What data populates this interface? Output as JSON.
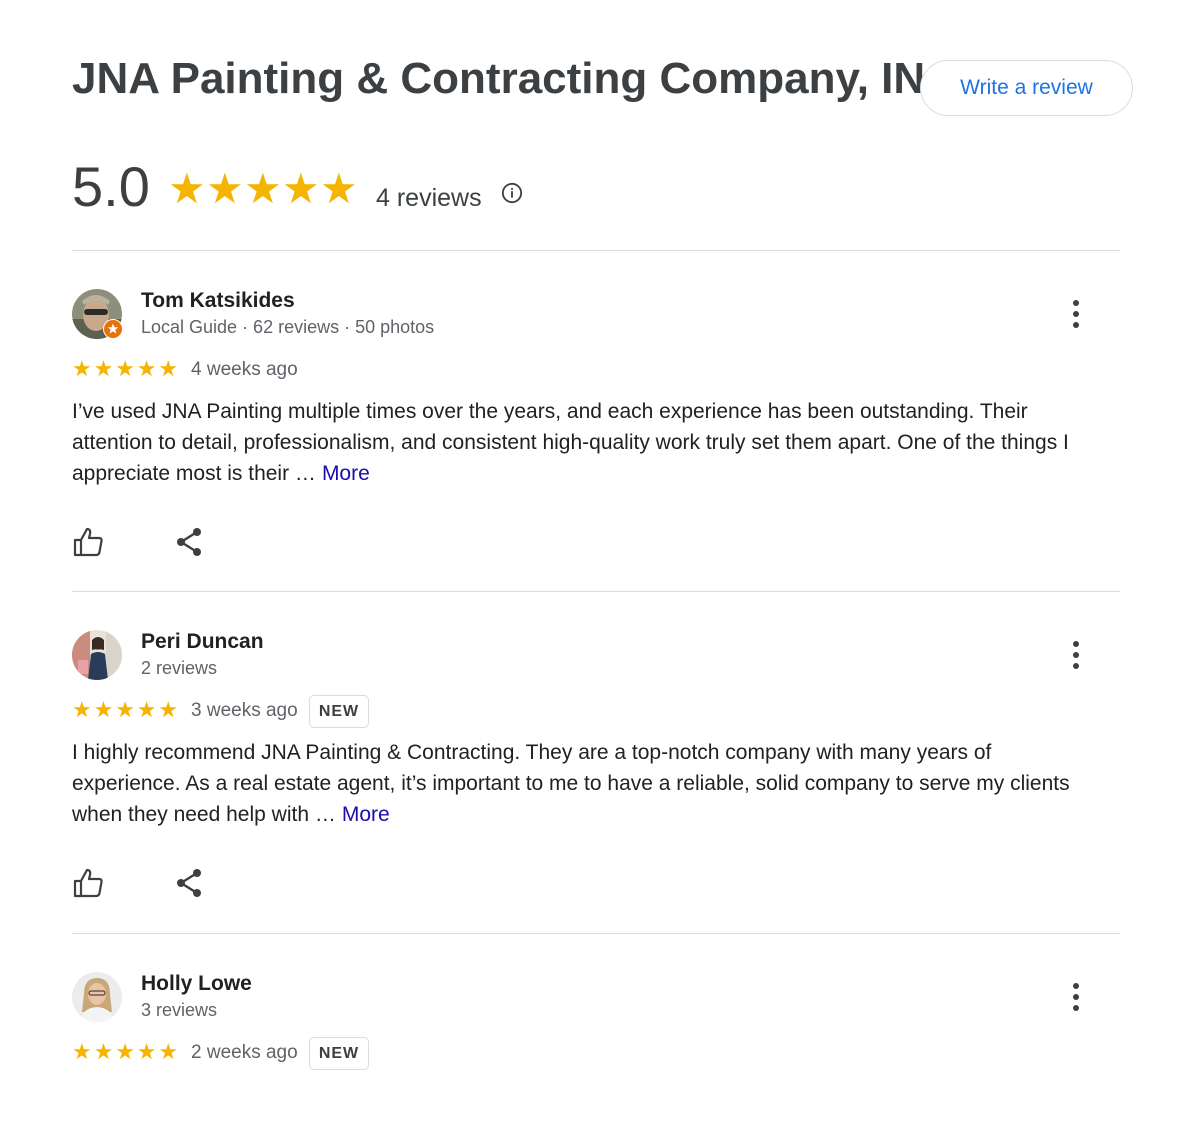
{
  "business": {
    "name": "JNA Painting & Contracting Company, INC",
    "write_review_label": "Write a review"
  },
  "summary": {
    "score": "5.0",
    "stars": 5,
    "review_count": "4 reviews",
    "star_color": "#f4b400"
  },
  "icons": {
    "info": "info-icon",
    "like": "thumbs-up-icon",
    "share": "share-icon",
    "menu": "more-vert-icon",
    "local_guide": "local-guide-badge-icon"
  },
  "reviews": [
    {
      "name": "Tom Katsikides",
      "meta": "Local Guide · 62 reviews · 50 photos",
      "rating": 5,
      "date": "4 weeks ago",
      "badge": "",
      "text": "I’ve used JNA Painting multiple times over the years, and each experience has been outstanding. Their attention to detail, professionalism, and consistent high-quality work truly set them apart. One of the things I appreciate most is their …",
      "more_label": "More"
    },
    {
      "name": "Peri Duncan",
      "meta": "2 reviews",
      "rating": 5,
      "date": "3 weeks ago",
      "badge": "NEW",
      "text": "I highly recommend JNA Painting & Contracting. They are a top-notch company with many years of experience. As a real estate agent, it’s important to me to have a reliable, solid company to serve my clients when they need help with …",
      "more_label": "More"
    },
    {
      "name": "Holly Lowe",
      "meta": "3 reviews",
      "rating": 5,
      "date": "2 weeks ago",
      "badge": "NEW"
    }
  ]
}
